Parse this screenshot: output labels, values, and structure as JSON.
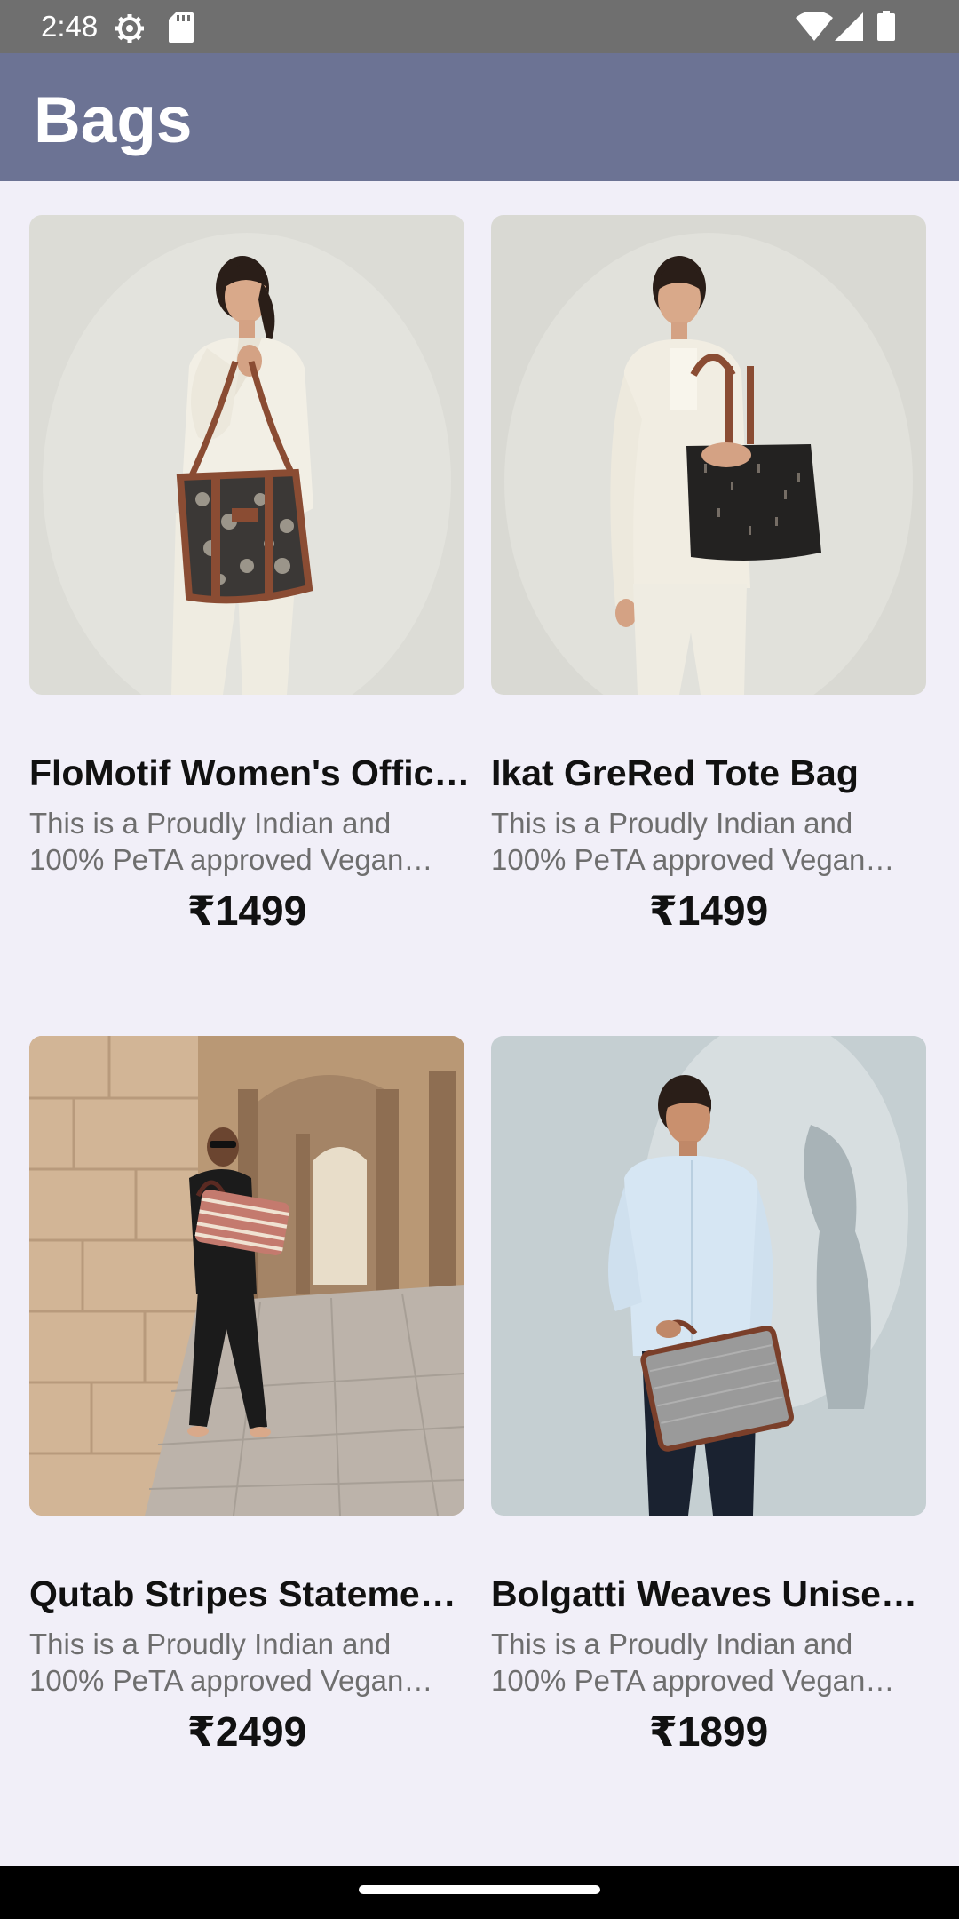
{
  "status_bar": {
    "time": "2:48",
    "icons": [
      "settings-gear-icon",
      "sd-card-icon",
      "wifi-icon",
      "cellular-signal-icon",
      "battery-icon"
    ]
  },
  "app_bar": {
    "title": "Bags",
    "background_color": "#6c7394"
  },
  "products": [
    {
      "name": "FloMotif Women's Office Tote Bag",
      "description": "This is a Proudly Indian and 100% PeTA approved Vegan product",
      "price": "₹1499",
      "image": "woman-white-suit-floral-tote-photo"
    },
    {
      "name": "Ikat GreRed Tote Bag",
      "description": "This is a Proudly Indian and 100% PeTA approved Vegan product",
      "price": "₹1499",
      "image": "woman-white-suit-black-tote-photo"
    },
    {
      "name": "Qutab Stripes Statement Tote",
      "description": "This is a Proudly Indian and 100% PeTA approved Vegan statement bag",
      "price": "₹2499",
      "image": "woman-black-outfit-striped-bag-corridor-photo"
    },
    {
      "name": "Bolgatti Weaves Unisex Laptop Bag",
      "description": "This is a Proudly Indian and 100% PeTA approved Vegan product",
      "price": "₹1899",
      "image": "man-blue-shirt-grey-laptop-bag-photo"
    }
  ]
}
